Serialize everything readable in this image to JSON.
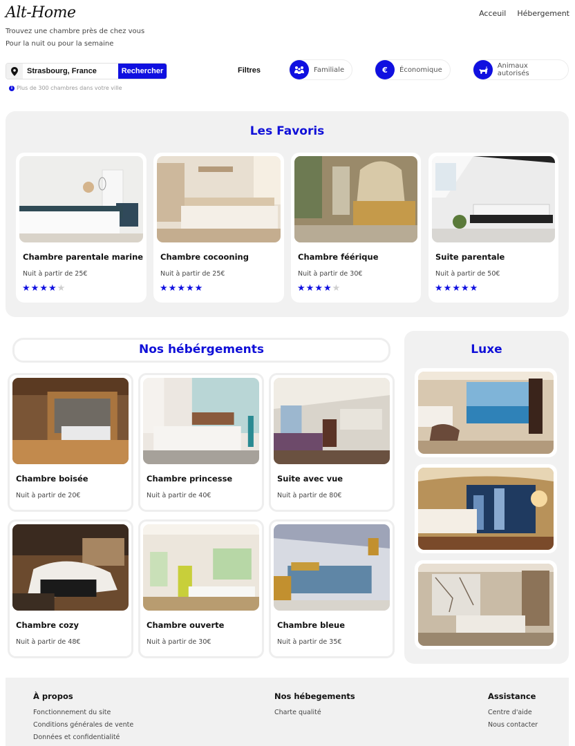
{
  "header": {
    "logo": "Alt-Home",
    "nav": [
      "Acceuil",
      "Hébergement"
    ],
    "tagline1": "Trouvez une chambre près de chez vous",
    "tagline2": "Pour la nuit ou pour la semaine"
  },
  "search": {
    "value": "Strasbourg, France",
    "button": "Rechercher",
    "hint": "Plus de 300 chambres dans votre ville"
  },
  "filters": {
    "label": "Filtres",
    "items": [
      {
        "label": "Familiale",
        "icon": "family-icon"
      },
      {
        "label": "Économique",
        "icon": "euro-icon"
      },
      {
        "label": "Animaux autorisés",
        "icon": "pet-icon"
      }
    ]
  },
  "favoris": {
    "title": "Les Favoris",
    "items": [
      {
        "name": "Chambre parentale marine",
        "price": "Nuit à partir de 25€",
        "rating": 4
      },
      {
        "name": "Chambre cocooning",
        "price": "Nuit à partir de 25€",
        "rating": 5
      },
      {
        "name": "Chambre féérique",
        "price": "Nuit à partir de 30€",
        "rating": 4
      },
      {
        "name": "Suite parentale",
        "price": "Nuit à partir de 50€",
        "rating": 5
      }
    ]
  },
  "nos": {
    "title": "Nos hébérgements",
    "items": [
      {
        "name": "Chambre boisée",
        "price": "Nuit à partir de 20€"
      },
      {
        "name": "Chambre princesse",
        "price": "Nuit à partir de 40€"
      },
      {
        "name": "Suite avec vue",
        "price": "Nuit à partir de 80€"
      },
      {
        "name": "Chambre cozy",
        "price": "Nuit à partir de 48€"
      },
      {
        "name": "Chambre ouverte",
        "price": "Nuit à partir de 30€"
      },
      {
        "name": "Chambre bleue",
        "price": "Nuit à partir de 35€"
      }
    ]
  },
  "luxe": {
    "title": "Luxe"
  },
  "footer": {
    "col1": {
      "title": "À propos",
      "links": [
        "Fonctionnement du site",
        "Conditions générales de vente",
        "Données et confidentialité"
      ]
    },
    "col2": {
      "title": "Nos hébegements",
      "links": [
        "Charte qualité"
      ]
    },
    "col3": {
      "title": "Assistance",
      "links": [
        "Centre d'aide",
        "Nous contacter"
      ]
    }
  },
  "colors": {
    "accent": "#1010e0",
    "panel": "#f1f1f1"
  }
}
